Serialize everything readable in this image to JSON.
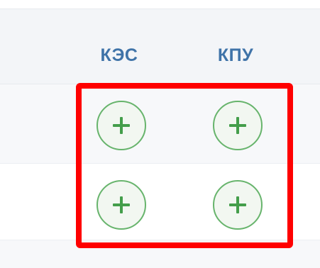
{
  "table": {
    "columns": {
      "kes": "КЭС",
      "kpu": "КПУ"
    },
    "rows": [
      {
        "kes_button": "plus-icon",
        "kpu_button": "plus-icon"
      },
      {
        "kes_button": "plus-icon",
        "kpu_button": "plus-icon"
      }
    ]
  },
  "colors": {
    "header_text": "#3f73a8",
    "button_border": "#67b46c",
    "button_plus": "#449e4b",
    "highlight": "#ff0000",
    "header_background": "#f3f5f8"
  }
}
